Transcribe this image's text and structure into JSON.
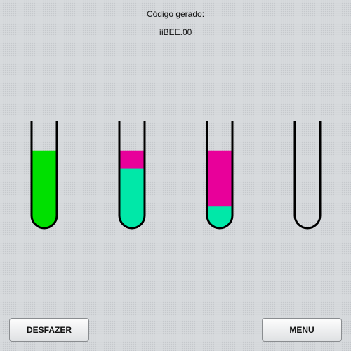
{
  "header": {
    "label": "Código gerado:",
    "code": "íiBEE.00"
  },
  "colors": {
    "green": "#00e000",
    "teal": "#00e8a8",
    "magenta": "#e8009a",
    "tube_outline": "#000000"
  },
  "tubes": [
    {
      "name": "tube-1",
      "layers": [
        {
          "color": "green",
          "fill": 0.74
        }
      ]
    },
    {
      "name": "tube-2",
      "layers": [
        {
          "color": "teal",
          "fill": 0.57
        },
        {
          "color": "magenta",
          "fill": 0.17
        }
      ]
    },
    {
      "name": "tube-3",
      "layers": [
        {
          "color": "teal",
          "fill": 0.21
        },
        {
          "color": "magenta",
          "fill": 0.53
        }
      ]
    },
    {
      "name": "tube-4",
      "layers": []
    }
  ],
  "buttons": {
    "undo": "DESFAZER",
    "menu": "MENU"
  }
}
